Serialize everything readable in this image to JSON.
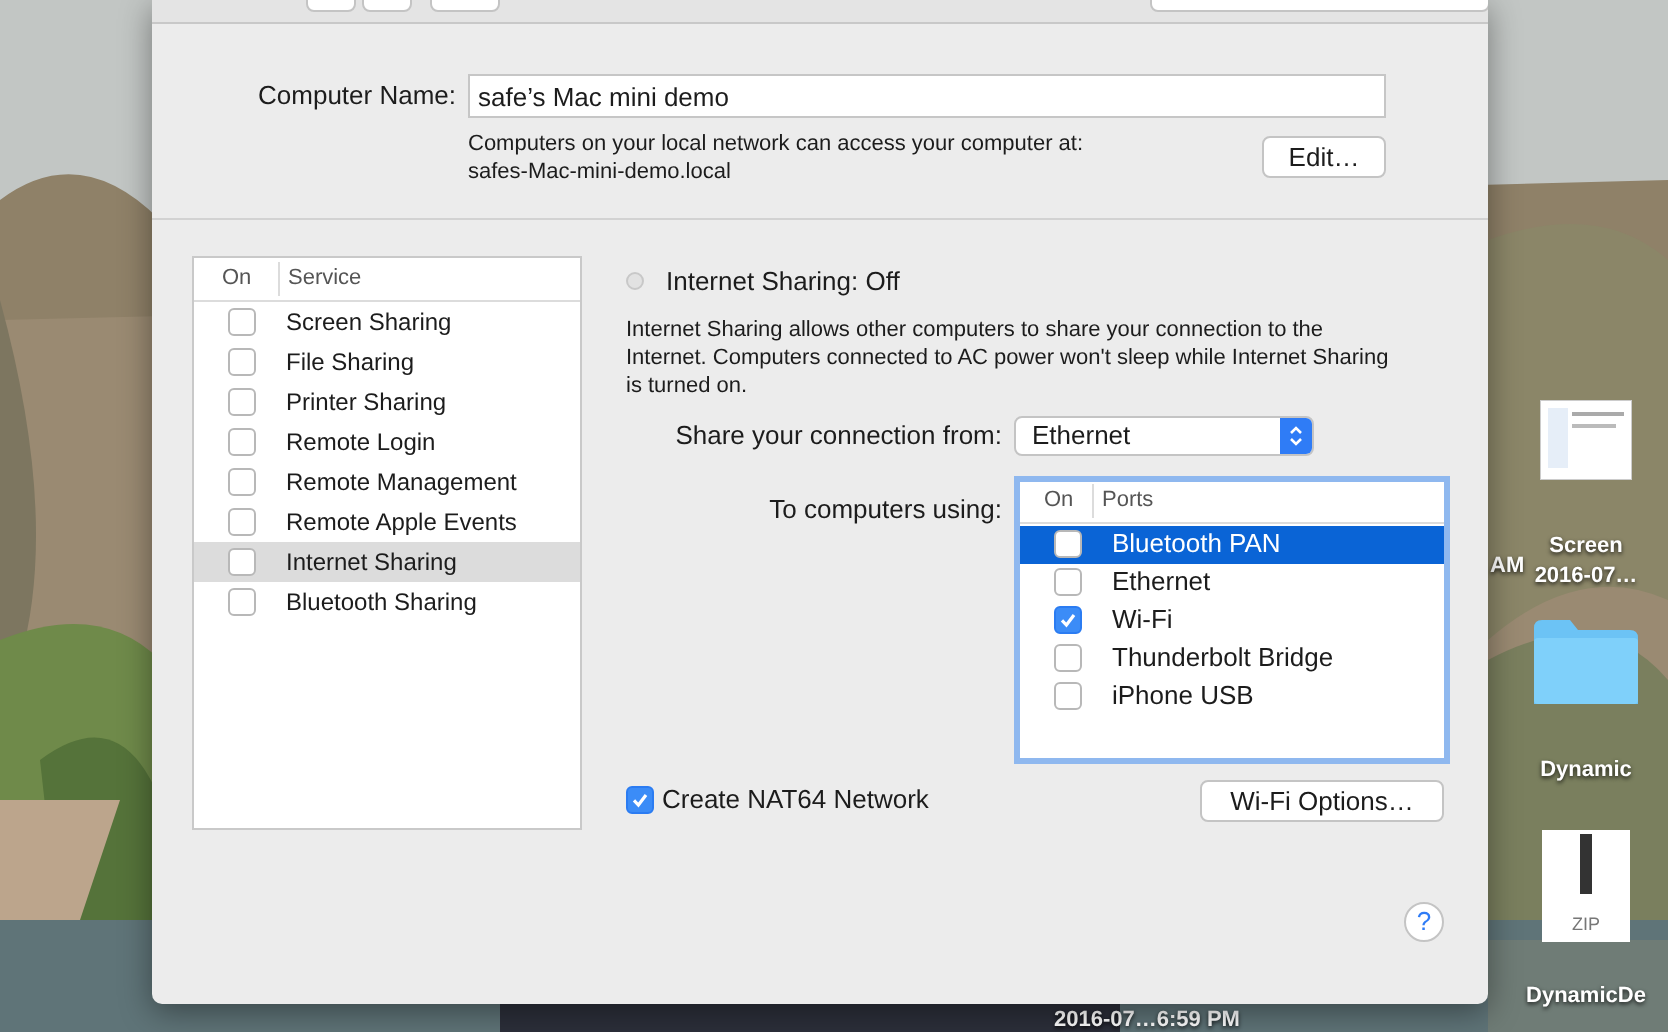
{
  "computer_name": {
    "label": "Computer Name:",
    "value": "safe’s Mac mini demo",
    "note": "Computers on your local network can access your computer at:",
    "address": "safes-Mac-mini-demo.local",
    "edit_button": "Edit…"
  },
  "services": {
    "columns": [
      "On",
      "Service"
    ],
    "items": [
      {
        "label": "Screen Sharing",
        "checked": false,
        "selected": false
      },
      {
        "label": "File Sharing",
        "checked": false,
        "selected": false
      },
      {
        "label": "Printer Sharing",
        "checked": false,
        "selected": false
      },
      {
        "label": "Remote Login",
        "checked": false,
        "selected": false
      },
      {
        "label": "Remote Management",
        "checked": false,
        "selected": false
      },
      {
        "label": "Remote Apple Events",
        "checked": false,
        "selected": false
      },
      {
        "label": "Internet Sharing",
        "checked": false,
        "selected": true
      },
      {
        "label": "Bluetooth Sharing",
        "checked": false,
        "selected": false
      }
    ]
  },
  "status": {
    "label": "Internet Sharing: Off",
    "on": false
  },
  "description": "Internet Sharing allows other computers to share your connection to the Internet. Computers connected to AC power won't sleep while Internet Sharing is turned on.",
  "share_from": {
    "label": "Share your connection from:",
    "value": "Ethernet"
  },
  "to_computers": {
    "label": "To computers using:",
    "columns": [
      "On",
      "Ports"
    ],
    "ports": [
      {
        "label": "Bluetooth PAN",
        "checked": false,
        "selected": true
      },
      {
        "label": "Ethernet",
        "checked": false,
        "selected": false
      },
      {
        "label": "Wi-Fi",
        "checked": true,
        "selected": false
      },
      {
        "label": "Thunderbolt Bridge",
        "checked": false,
        "selected": false
      },
      {
        "label": "iPhone USB",
        "checked": false,
        "selected": false
      }
    ]
  },
  "nat64": {
    "label": "Create NAT64 Network",
    "checked": true
  },
  "wifi_options_button": "Wi-Fi Options…",
  "help_button": "?",
  "desktop": {
    "side_label": "AM",
    "bottom_label": "2016-07…6:59 PM",
    "items": [
      {
        "kind": "screenshot",
        "label_lines": [
          "Screen",
          "2016-07…"
        ]
      },
      {
        "kind": "folder",
        "label_lines": [
          "Dynamic"
        ]
      },
      {
        "kind": "zip",
        "badge": "ZIP",
        "label_lines": [
          "DynamicDe"
        ]
      }
    ]
  }
}
